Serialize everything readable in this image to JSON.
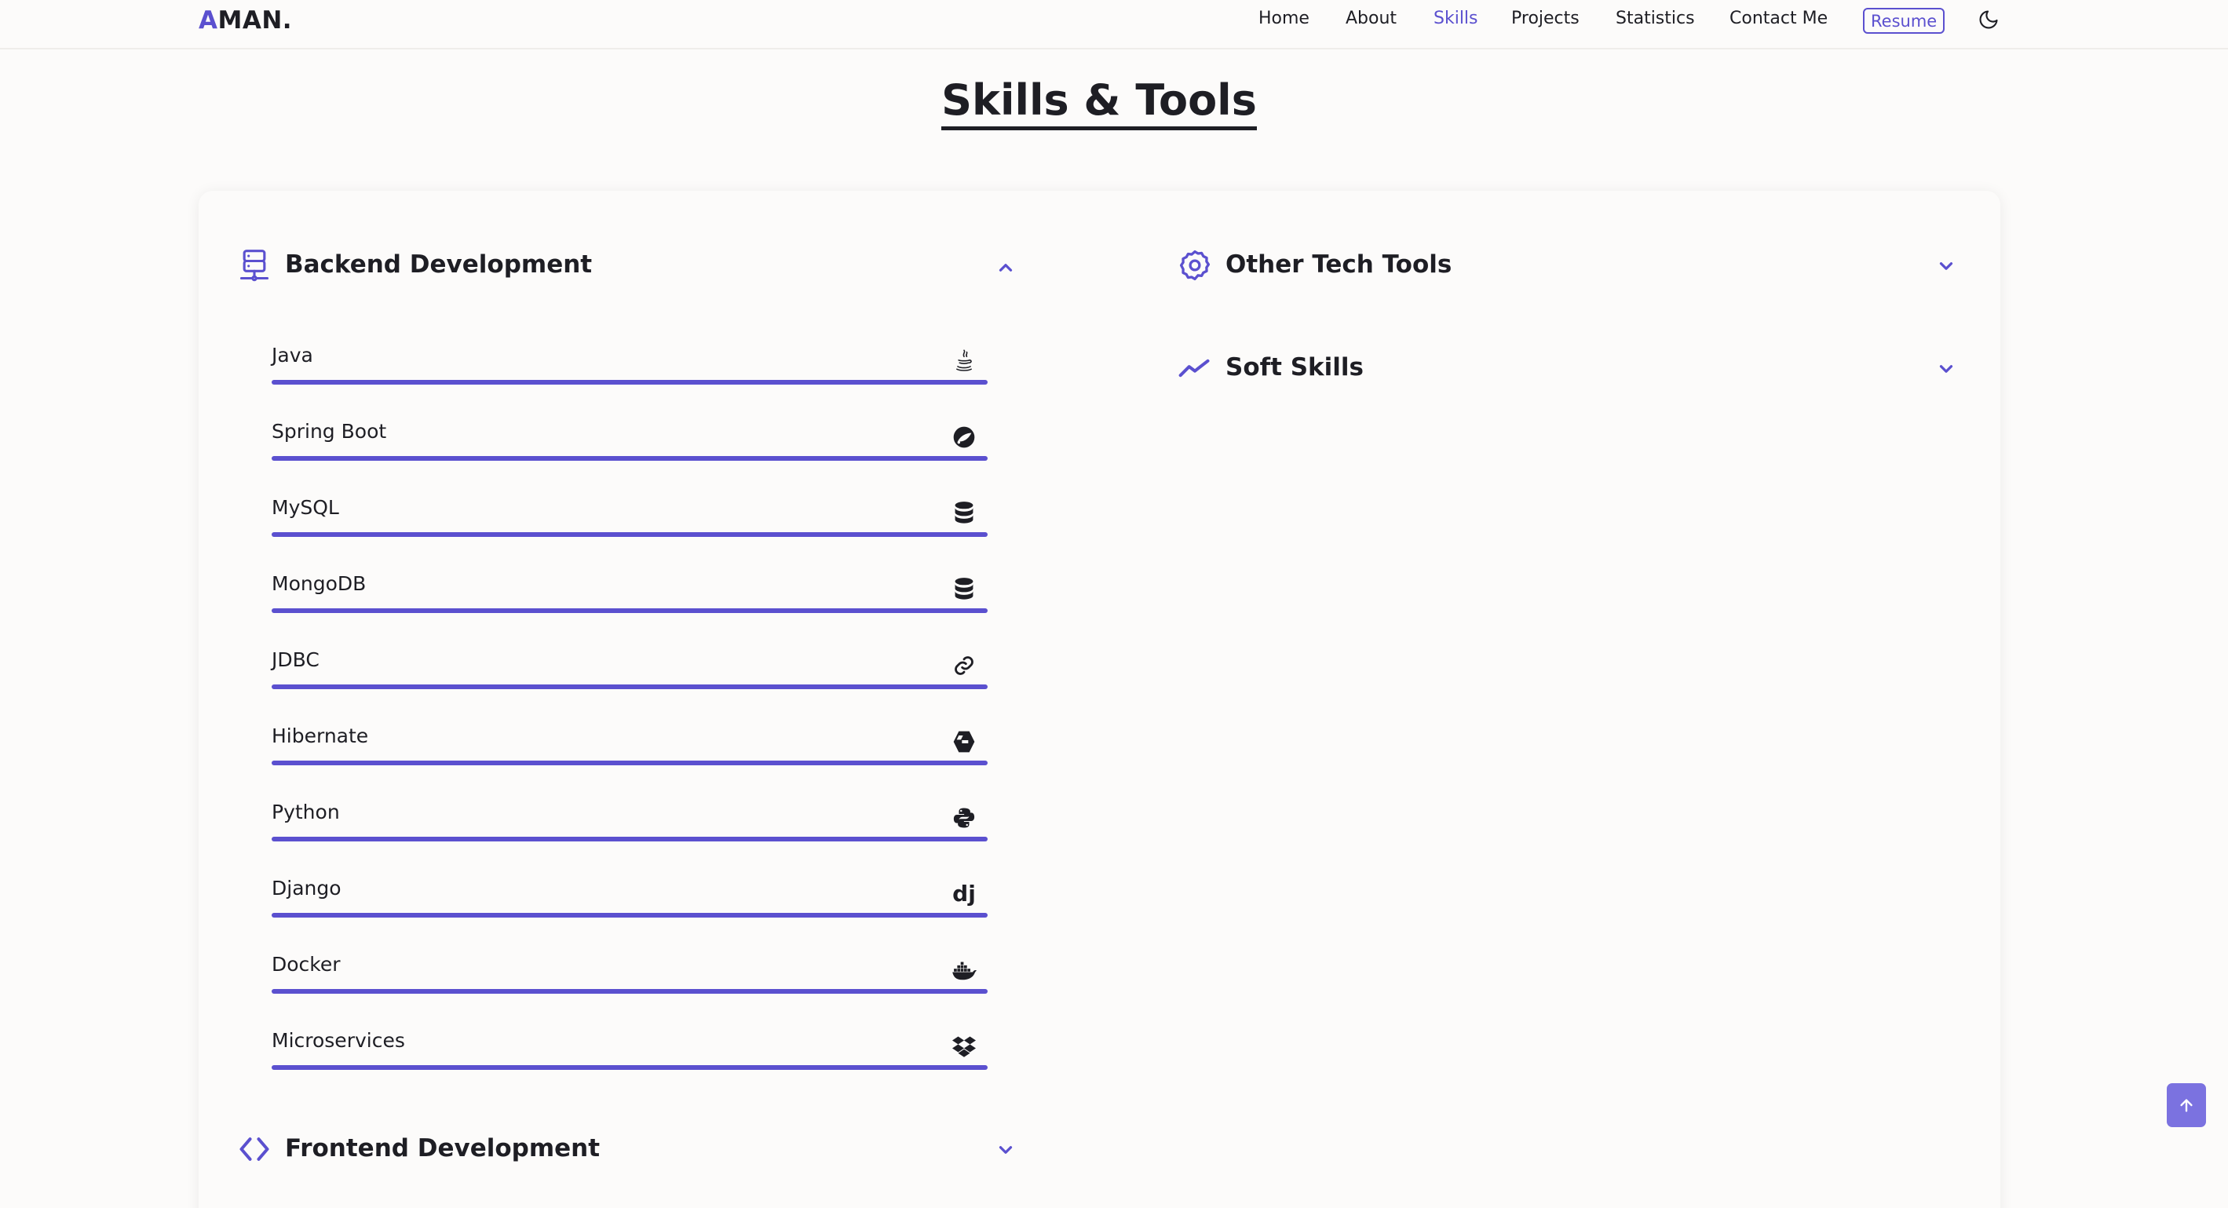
{
  "nav": {
    "logo_accent": "A",
    "logo_rest": "MAN.",
    "links": [
      {
        "label": "Home"
      },
      {
        "label": "About"
      },
      {
        "label": "Skills"
      },
      {
        "label": "Projects"
      },
      {
        "label": "Statistics"
      },
      {
        "label": "Contact Me"
      }
    ],
    "active_link": "Skills",
    "resume_label": "Resume",
    "theme_icon": "moon-icon"
  },
  "section": {
    "title": "Skills & Tools"
  },
  "categories": [
    {
      "title": "Backend Development",
      "icon": "server-icon",
      "expanded": true
    },
    {
      "title": "Other Tech Tools",
      "icon": "gear-icon",
      "expanded": false
    },
    {
      "title": "Soft Skills",
      "icon": "trend-line-icon",
      "expanded": false
    },
    {
      "title": "Frontend Development",
      "icon": "code-brackets-icon",
      "expanded": false
    }
  ],
  "backend_skills": [
    {
      "name": "Java",
      "icon": "java-icon",
      "level": 1.0
    },
    {
      "name": "Spring Boot",
      "icon": "spring-icon",
      "level": 1.0
    },
    {
      "name": "MySQL",
      "icon": "database-icon",
      "level": 1.0
    },
    {
      "name": "MongoDB",
      "icon": "database-icon",
      "level": 1.0
    },
    {
      "name": "JDBC",
      "icon": "link-icon",
      "level": 1.0
    },
    {
      "name": "Hibernate",
      "icon": "hibernate-icon",
      "level": 1.0
    },
    {
      "name": "Python",
      "icon": "python-icon",
      "level": 1.0
    },
    {
      "name": "Django",
      "icon": "django-icon",
      "level": 1.0
    },
    {
      "name": "Docker",
      "icon": "docker-icon",
      "level": 1.0
    },
    {
      "name": "Microservices",
      "icon": "dropbox-icon",
      "level": 1.0
    }
  ],
  "django_glyph": "dj",
  "colors": {
    "accent": "#5b50cf",
    "text": "#1e1e24",
    "background": "#fcfbfa",
    "scroll_top_bg": "#7b72e0"
  },
  "scroll_top_icon": "arrow-up-icon"
}
